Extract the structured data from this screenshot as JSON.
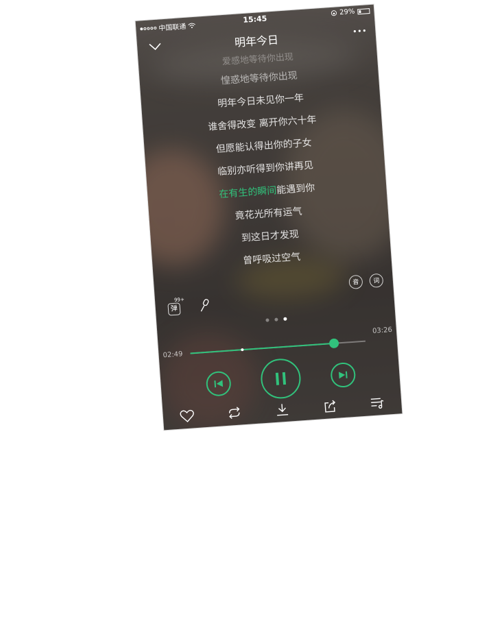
{
  "status_bar": {
    "carrier": "中国联通",
    "time": "15:45",
    "battery": "29%",
    "battery_level": 0.29
  },
  "nav": {
    "title": "明年今日",
    "back_icon": "chevron-down-icon",
    "more_icon": "more-dots-icon"
  },
  "lyrics": {
    "previous": "爱感地等待你出现",
    "lines": [
      "惶惑地等待你出现",
      "明年今日未见你一年",
      "谁舍得改变 离开你六十年",
      "但愿能认得出你的子女",
      "临别亦听得到你讲再见"
    ],
    "current_played": "在有生的瞬间",
    "current_rest": "能遇到你",
    "upcoming": [
      "竟花光所有运气",
      "到这日才发现",
      "曾呼吸过空气"
    ]
  },
  "side_actions": {
    "quality_label": "音",
    "lyrics_label": "词"
  },
  "left_actions": {
    "danmaku_badge": "99+",
    "danmaku_label": "弹",
    "mic_icon": "microphone-icon"
  },
  "page_dots": {
    "count": 3,
    "active": 2
  },
  "progress": {
    "current_time": "02:49",
    "total_time": "03:26",
    "played_fraction": 0.82,
    "buffer_marker_fraction": 0.29
  },
  "controls": {
    "prev_icon": "skip-previous-icon",
    "play_icon": "pause-icon",
    "next_icon": "skip-next-icon"
  },
  "bottom_bar": [
    {
      "icon": "heart-icon"
    },
    {
      "icon": "repeat-icon"
    },
    {
      "icon": "download-icon"
    },
    {
      "icon": "share-icon"
    },
    {
      "icon": "playlist-icon"
    }
  ],
  "colors": {
    "accent": "#31c27c",
    "text": "#ffffff"
  }
}
